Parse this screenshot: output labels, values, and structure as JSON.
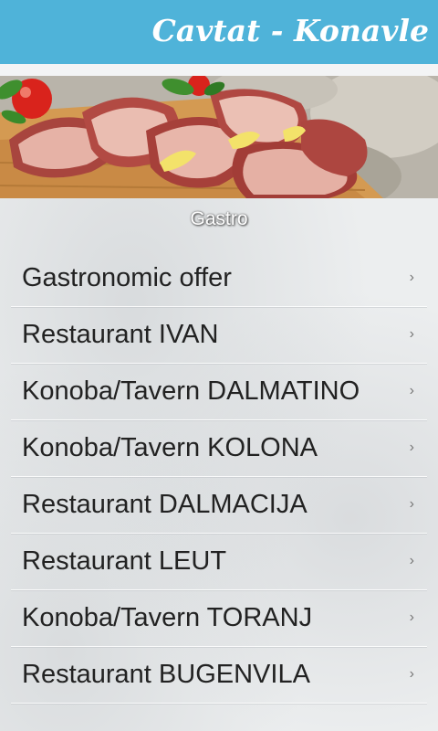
{
  "header": {
    "title": "Cavtat - Konavle"
  },
  "banner": {
    "image": "prosciutto-platter-photo"
  },
  "section": {
    "label": "Gastro"
  },
  "menu": {
    "items": [
      {
        "label": "Gastronomic offer"
      },
      {
        "label": "Restaurant IVAN"
      },
      {
        "label": "Konoba/Tavern DALMATINO"
      },
      {
        "label": "Konoba/Tavern KOLONA"
      },
      {
        "label": "Restaurant DALMACIJA"
      },
      {
        "label": "Restaurant LEUT"
      },
      {
        "label": "Konoba/Tavern TORANJ"
      },
      {
        "label": "Restaurant BUGENVILA"
      }
    ],
    "chevron": "›"
  },
  "colors": {
    "header": "#4fb3d9",
    "text": "#222222"
  }
}
